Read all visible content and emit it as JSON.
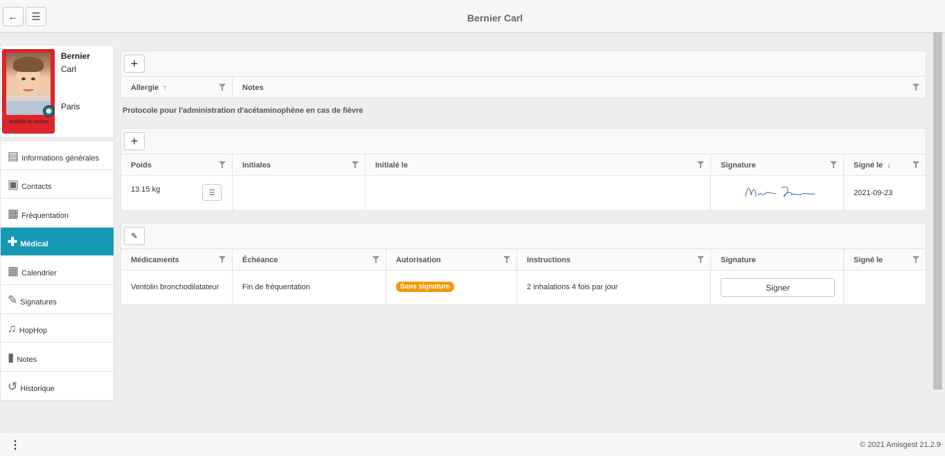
{
  "header": {
    "title": "Bernier Carl",
    "back_icon": "←",
    "menu_icon": "☰"
  },
  "profile": {
    "last_name": "Bernier",
    "first_name": "Carl",
    "city": "Paris",
    "photo_caption": "Modifier la couleur",
    "card_color": "#e0242b"
  },
  "nav": {
    "items": [
      {
        "label": "Informations générales",
        "icon": "id-card-icon"
      },
      {
        "label": "Contacts",
        "icon": "contacts-icon"
      },
      {
        "label": "Fréquentation",
        "icon": "attendance-icon"
      },
      {
        "label": "Médical",
        "icon": "medical-icon",
        "active": true
      },
      {
        "label": "Calendrier",
        "icon": "calendar-icon"
      },
      {
        "label": "Signatures",
        "icon": "signature-icon"
      },
      {
        "label": "HopHop",
        "icon": "bell-icon"
      },
      {
        "label": "Notes",
        "icon": "clipboard-icon"
      },
      {
        "label": "Historique",
        "icon": "history-icon"
      }
    ],
    "active_color": "#1799b6"
  },
  "allergies": {
    "add_label": "+",
    "columns": [
      "Allergie",
      "Notes"
    ],
    "sort_icon": "↑"
  },
  "protocol": {
    "title": "Protocole pour l'administration d'acétaminophène en cas de fièvre",
    "add_label": "+",
    "columns": [
      "Poids",
      "Initiales",
      "Initialé le",
      "Signature",
      "Signé le"
    ],
    "sort_icon": "↓",
    "rows": [
      {
        "poids": "13.15 kg",
        "initiales": "",
        "initiale_le": "",
        "signature": "Nathan Bernier",
        "signe_le": "2021-09-23"
      }
    ]
  },
  "medications": {
    "edit_label": "✎",
    "columns": [
      "Médicaments",
      "Échéance",
      "Autorisation",
      "Instructions",
      "Signature",
      "Signé le"
    ],
    "rows": [
      {
        "medicament": "Ventolin bronchodilatateur",
        "echeance": "Fin de fréquentation",
        "autorisation": "Sans signature",
        "instructions": "2 inhalations 4 fois par jour",
        "signature_button": "Signer",
        "signe_le": ""
      }
    ],
    "badge_color": "#f29a0a"
  },
  "footer": {
    "menu_dots": "⋮",
    "copyright": "© 2021 Amisgest 21.2.9"
  }
}
